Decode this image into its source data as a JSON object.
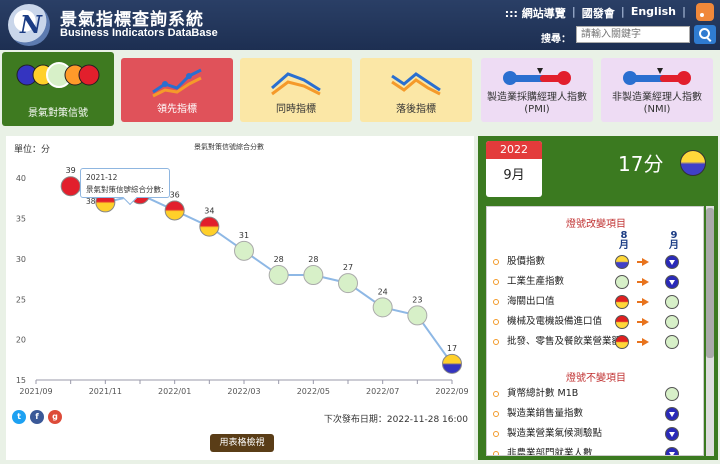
{
  "header": {
    "title": "景氣指標查詢系統",
    "subtitle": "Business Indicators DataBase",
    "links": [
      ":::  網站導覽",
      "國發會",
      "English"
    ],
    "search_label": "搜尋：",
    "search_placeholder": "請輸入關鍵字"
  },
  "tabs": [
    {
      "label": "景氣對策信號"
    },
    {
      "label": "領先指標"
    },
    {
      "label": "同時指標"
    },
    {
      "label": "落後指標"
    },
    {
      "label": "製造業採購經理人指數(PMI)"
    },
    {
      "label": "非製造業經理人指數(NMI)"
    }
  ],
  "chart": {
    "unit": "單位：分",
    "title": "景氣對策信號綜合分數",
    "tooltip_date": "2021-12",
    "tooltip_text": "景氣對策信號綜合分數: 38",
    "release": "下次發布日期：2022-11-28 16:00",
    "table_button": "用表格檢視"
  },
  "chart_data": {
    "type": "line",
    "title": "景氣對策信號綜合分數",
    "ylabel": "單位：分",
    "ylim": [
      15,
      42
    ],
    "yticks": [
      15,
      20,
      25,
      30,
      35,
      40
    ],
    "x": [
      "2021-09",
      "2021-10",
      "2021-11",
      "2021-12",
      "2022-01",
      "2022-02",
      "2022-03",
      "2022-04",
      "2022-05",
      "2022-06",
      "2022-07",
      "2022-08",
      "2022-09"
    ],
    "xtick_labels": [
      "2021/09",
      "2021/11",
      "2022/01",
      "2022/03",
      "2022/05",
      "2022/07",
      "2022/09"
    ],
    "values": [
      39,
      37,
      38,
      36,
      34,
      31,
      28,
      28,
      27,
      24,
      23,
      17
    ],
    "signals": [
      "red",
      "yellow-red",
      "red",
      "yellow-red",
      "yellow-red",
      "green",
      "green",
      "green",
      "green",
      "green",
      "green",
      "yellow-blue"
    ],
    "colors": {
      "line": "#8eb8e5",
      "red": "#e21f2c",
      "green": "#d7f0c8",
      "blue": "#3434c0",
      "yellow": "#ffd02a"
    }
  },
  "signal_panel": {
    "year": "2022",
    "month": "9月",
    "score": "17分",
    "changed_title": "燈號改變項目",
    "unchanged_title": "燈號不變項目",
    "col_prev": "8月",
    "col_curr": "9月",
    "changed": [
      {
        "name": "股價指數",
        "prev": "yellow-blue",
        "curr": "blue"
      },
      {
        "name": "工業生產指數",
        "prev": "green",
        "curr": "blue"
      },
      {
        "name": "海關出口值",
        "prev": "yellow-red",
        "curr": "green"
      },
      {
        "name": "機械及電機設備進口值",
        "prev": "yellow-red",
        "curr": "green"
      },
      {
        "name": "批發、零售及餐飲業營業額",
        "prev": "yellow-red",
        "curr": "green"
      }
    ],
    "unchanged": [
      {
        "name": "貨幣總計數 M1B",
        "curr": "green"
      },
      {
        "name": "製造業銷售量指數",
        "curr": "blue"
      },
      {
        "name": "製造業營業氣候測驗點",
        "curr": "blue"
      },
      {
        "name": "非農業部門就業人數",
        "curr": "blue"
      }
    ]
  }
}
